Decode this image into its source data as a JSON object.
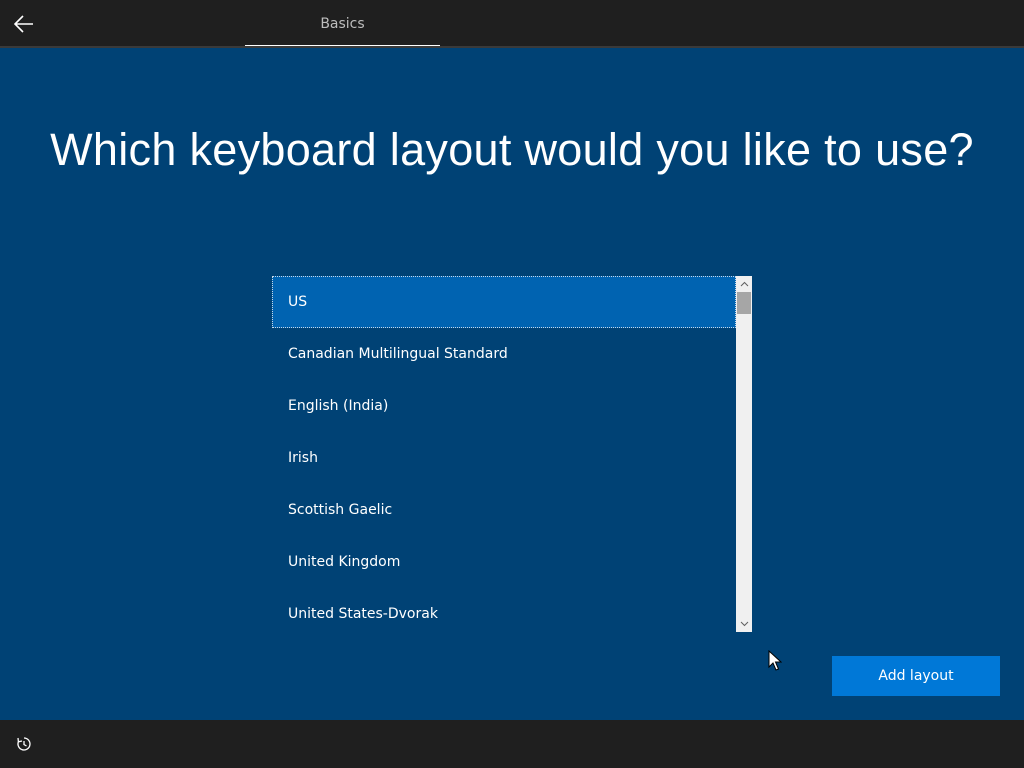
{
  "header": {
    "back_icon": "arrow-left-icon",
    "tab_label": "Basics"
  },
  "main": {
    "title": "Which keyboard layout would you like to use?",
    "layouts": [
      {
        "label": "US",
        "selected": true
      },
      {
        "label": "Canadian Multilingual Standard",
        "selected": false
      },
      {
        "label": "English (India)",
        "selected": false
      },
      {
        "label": "Irish",
        "selected": false
      },
      {
        "label": "Scottish Gaelic",
        "selected": false
      },
      {
        "label": "United Kingdom",
        "selected": false
      },
      {
        "label": "United States-Dvorak",
        "selected": false
      }
    ],
    "add_layout_label": "Add layout"
  },
  "footer": {
    "accessibility_icon": "ease-of-access-icon"
  },
  "colors": {
    "background": "#004275",
    "bar": "#1f1f1f",
    "selection": "#0063b1",
    "accent": "#0078d7"
  }
}
